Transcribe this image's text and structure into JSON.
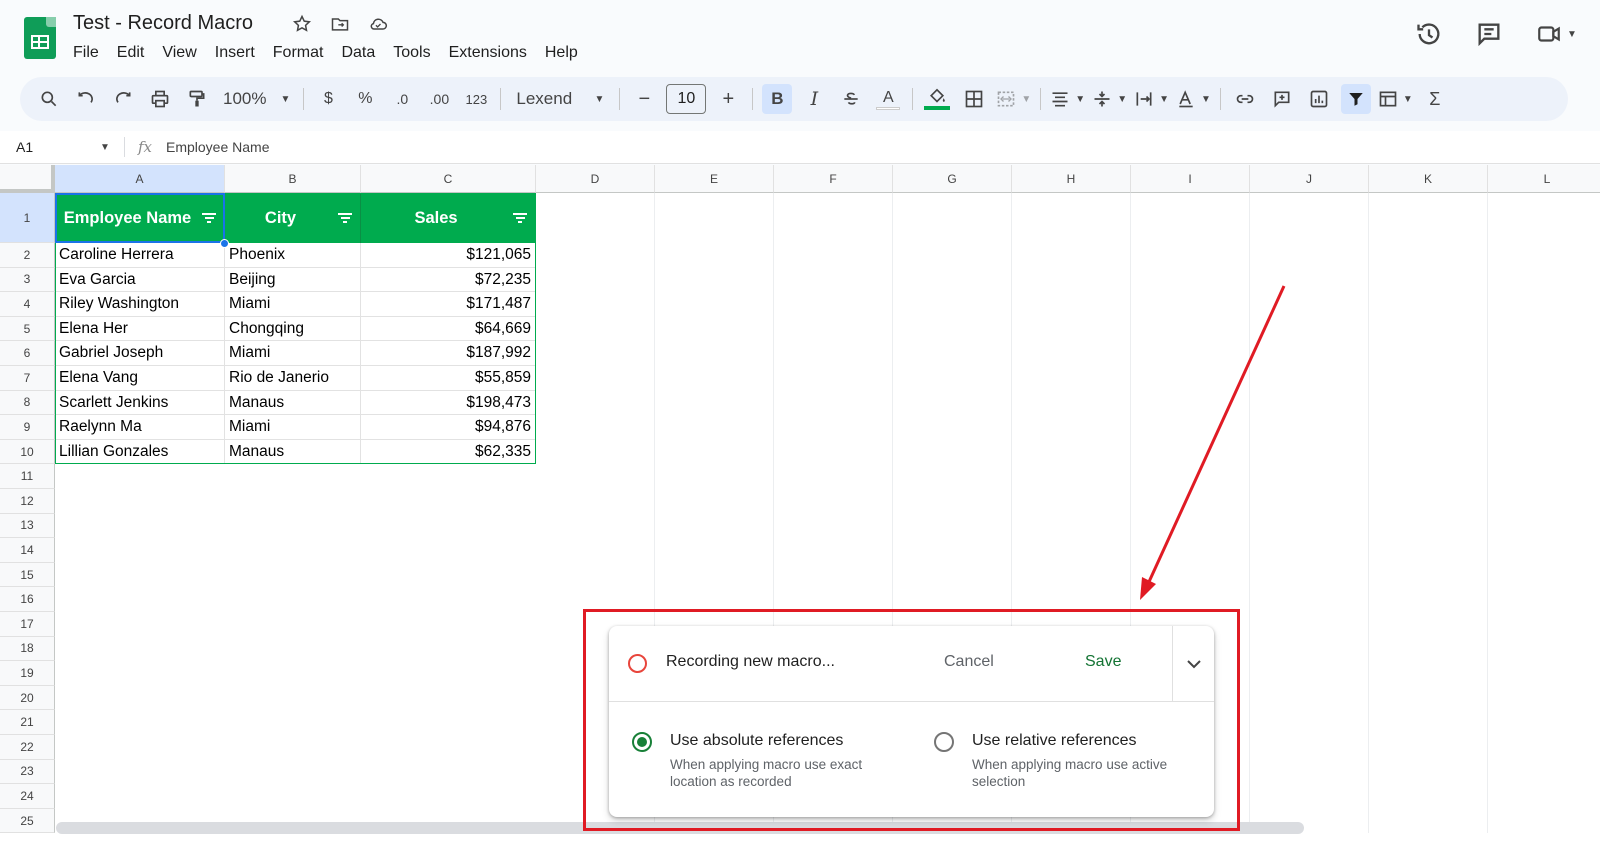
{
  "document": {
    "title": "Test - Record Macro",
    "title_icons": [
      "star-icon",
      "move-to-folder-icon",
      "cloud-saved-icon"
    ]
  },
  "menubar": [
    "File",
    "Edit",
    "View",
    "Insert",
    "Format",
    "Data",
    "Tools",
    "Extensions",
    "Help"
  ],
  "header_right_icons": [
    "version-history-icon",
    "comments-icon",
    "meet-video-icon"
  ],
  "toolbar": {
    "zoom": "100%",
    "currency": "$",
    "percent": "%",
    "decrease_decimal": ".0",
    "increase_decimal": ".00",
    "number_format": "123",
    "font": "Lexend",
    "font_size": "10",
    "bold": "B",
    "italic": "I",
    "text_color": "A"
  },
  "formula_bar": {
    "name_box": "A1",
    "fx": "fx",
    "content": "Employee Name"
  },
  "columns": [
    "A",
    "B",
    "C",
    "D",
    "E",
    "F",
    "G",
    "H",
    "I",
    "J",
    "K",
    "L"
  ],
  "rows": [
    "1",
    "2",
    "3",
    "4",
    "5",
    "6",
    "7",
    "8",
    "9",
    "10",
    "11",
    "12",
    "13",
    "14",
    "15",
    "16",
    "17",
    "18",
    "19",
    "20",
    "21",
    "22",
    "23",
    "24",
    "25"
  ],
  "table": {
    "headers": [
      "Employee Name",
      "City",
      "Sales"
    ],
    "rows": [
      [
        "Caroline Herrera",
        "Phoenix",
        "$121,065"
      ],
      [
        "Eva Garcia",
        "Beijing",
        "$72,235"
      ],
      [
        "Riley Washington",
        "Miami",
        "$171,487"
      ],
      [
        "Elena Her",
        "Chongqing",
        "$64,669"
      ],
      [
        "Gabriel Joseph",
        "Miami",
        "$187,992"
      ],
      [
        "Elena Vang",
        "Rio de Janerio",
        "$55,859"
      ],
      [
        "Scarlett Jenkins",
        "Manaus",
        "$198,473"
      ],
      [
        "Raelynn Ma",
        "Miami",
        "$94,876"
      ],
      [
        "Lillian Gonzales",
        "Manaus",
        "$62,335"
      ]
    ]
  },
  "macro_panel": {
    "status": "Recording new macro...",
    "cancel": "Cancel",
    "save": "Save",
    "options": [
      {
        "title": "Use absolute references",
        "description": "When applying macro use exact location as recorded",
        "selected": true
      },
      {
        "title": "Use relative references",
        "description": "When applying macro use active selection",
        "selected": false
      }
    ]
  },
  "colors": {
    "header_fill": "#00ab4e",
    "accent": "#1a73e8",
    "annotation": "#e01b24",
    "save_text": "#137333"
  }
}
